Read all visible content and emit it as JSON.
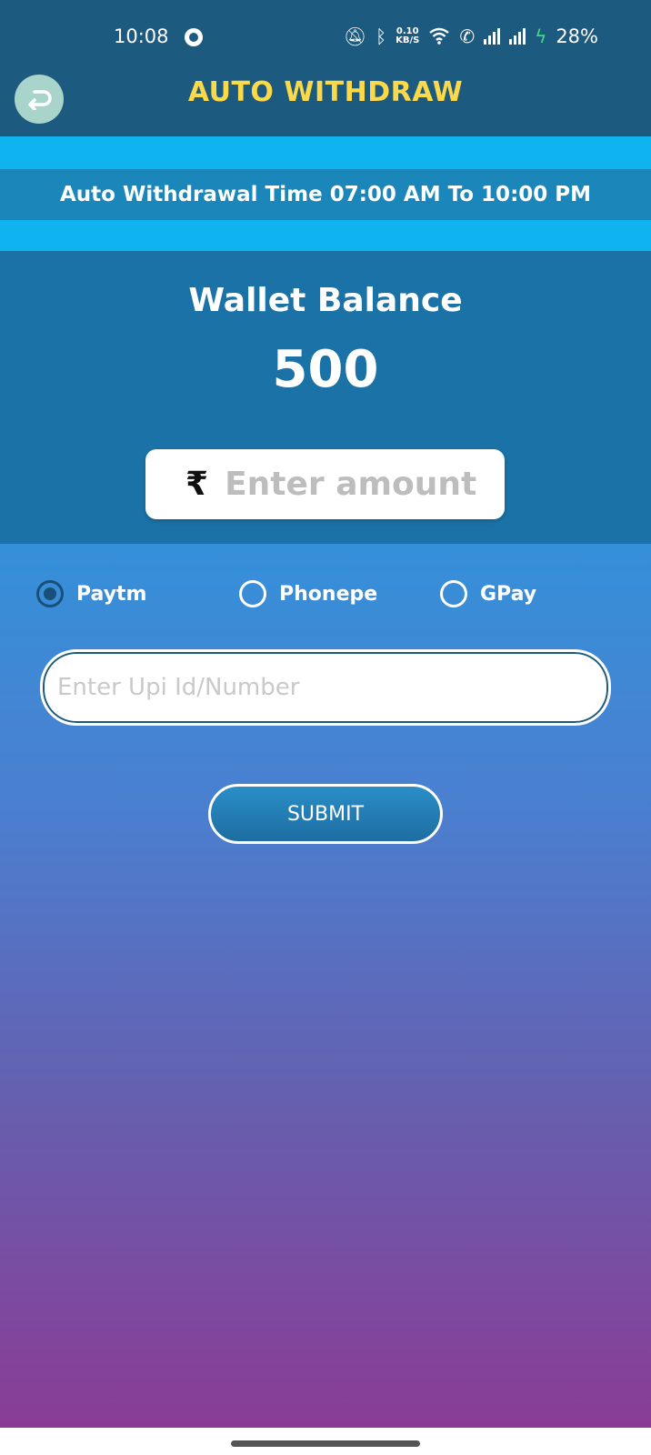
{
  "status_bar": {
    "time": "10:08",
    "net_speed_value": "0.10",
    "net_speed_unit": "KB/S",
    "battery": "28%",
    "icons": [
      "mute-icon",
      "bluetooth-icon",
      "wifi-icon",
      "wifi-call-icon",
      "signal-icon",
      "signal-icon-2",
      "charging-icon"
    ]
  },
  "app_bar": {
    "title": "AUTO WITHDRAW",
    "back_icon": "back-arrow-icon"
  },
  "banner": {
    "text": "Auto Withdrawal Time 07:00 AM To 10:00 PM"
  },
  "wallet": {
    "label": "Wallet Balance",
    "balance": "500",
    "currency_symbol": "₹",
    "amount_placeholder": "Enter amount"
  },
  "payment": {
    "options": [
      {
        "label": "Paytm",
        "selected": true
      },
      {
        "label": "Phonepe",
        "selected": false
      },
      {
        "label": "GPay",
        "selected": false
      }
    ],
    "upi_placeholder": "Enter Upi Id/Number",
    "submit_label": "SUBMIT"
  },
  "colors": {
    "header": "#1c5a7f",
    "title": "#fcd948",
    "stripe": "#0fb3f0",
    "banner": "#1a86b9",
    "wallet_panel": "#1a72a6",
    "gradient_top": "#3590d9",
    "gradient_bottom": "#8a3c95"
  }
}
